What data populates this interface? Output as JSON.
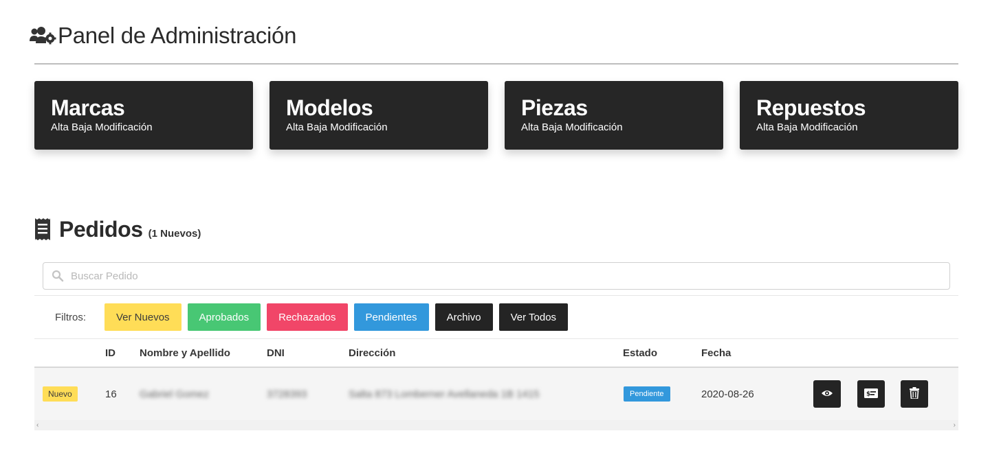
{
  "header": {
    "title": "Panel de Administración",
    "icon": "users-cog-icon"
  },
  "cards": [
    {
      "title": "Marcas",
      "subtitle": "Alta Baja Modificación"
    },
    {
      "title": "Modelos",
      "subtitle": "Alta Baja Modificación"
    },
    {
      "title": "Piezas",
      "subtitle": "Alta Baja Modificación"
    },
    {
      "title": "Repuestos",
      "subtitle": "Alta Baja Modificación"
    }
  ],
  "orders": {
    "title": "Pedidos",
    "count_label": "(1 Nuevos)",
    "icon": "receipt-icon",
    "search": {
      "placeholder": "Buscar Pedido",
      "value": ""
    },
    "filters_label": "Filtros:",
    "filters": [
      {
        "label": "Ver Nuevos",
        "color": "#ffdd57"
      },
      {
        "label": "Aprobados",
        "color": "#48c774"
      },
      {
        "label": "Rechazados",
        "color": "#f14668"
      },
      {
        "label": "Pendientes",
        "color": "#3298dc"
      },
      {
        "label": "Archivo",
        "color": "#242424"
      },
      {
        "label": "Ver Todos",
        "color": "#242424"
      }
    ],
    "columns": [
      "ID",
      "Nombre y Apellido",
      "DNI",
      "Dirección",
      "Estado",
      "Fecha"
    ],
    "rows": [
      {
        "badge": "Nuevo",
        "id": "16",
        "name": "Gabriel Gomez",
        "dni": "3728393",
        "address": "Salta 873 Lomberner Avellaneda 1B 1415",
        "status": "Pendiente",
        "date": "2020-08-26",
        "actions": [
          "eye-icon",
          "money-check-icon",
          "trash-icon"
        ]
      }
    ]
  }
}
